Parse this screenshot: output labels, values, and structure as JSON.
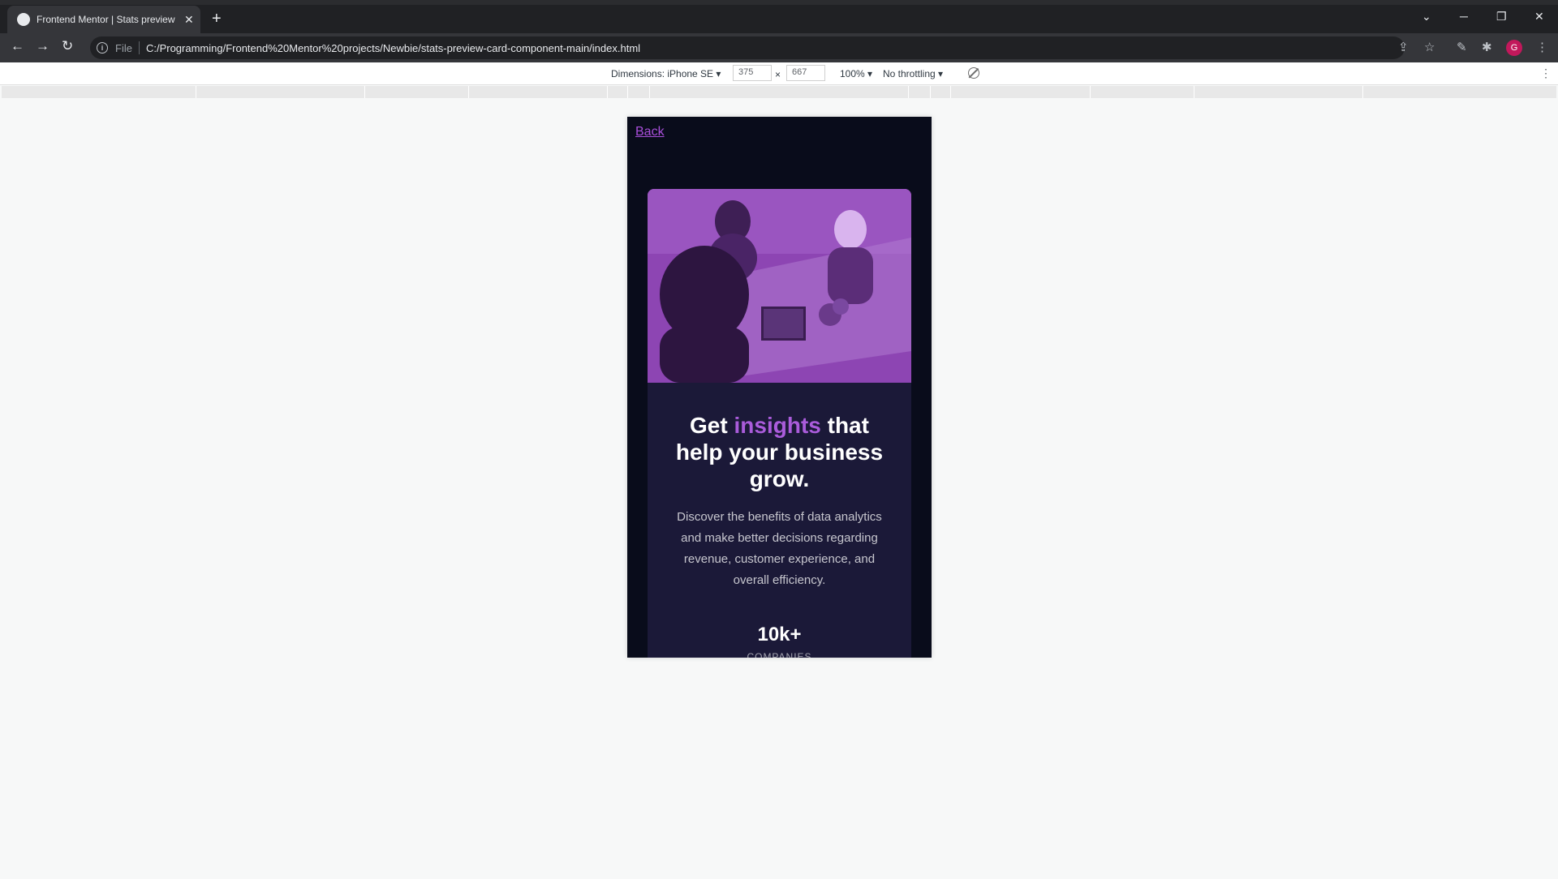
{
  "browser": {
    "tab_title": "Frontend Mentor | Stats preview",
    "file_label": "File",
    "url": "C:/Programming/Frontend%20Mentor%20projects/Newbie/stats-preview-card-component-main/index.html",
    "profile_initial": "G"
  },
  "device_toolbar": {
    "dimensions_label": "Dimensions: iPhone SE",
    "width": "375",
    "times": "×",
    "height": "667",
    "zoom": "100%",
    "throttling": "No throttling"
  },
  "page": {
    "back_link": "Back",
    "title_start": "Get ",
    "title_accent": "insights",
    "title_end": " that help your business grow.",
    "description": "Discover the benefits of data analytics and make better decisions regarding revenue, customer experience, and overall efficiency.",
    "stats": [
      {
        "value": "10k+",
        "label": "companies"
      }
    ]
  },
  "colors": {
    "page_bg": "#090c1b",
    "card_bg": "#1b1938",
    "accent": "#aa5cdb",
    "image_tint": "#8d45b3"
  }
}
